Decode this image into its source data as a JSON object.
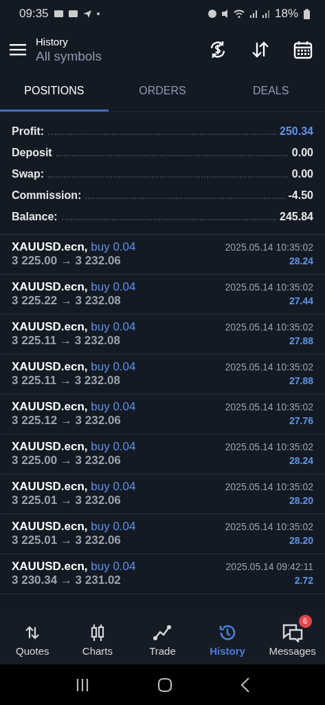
{
  "status_bar": {
    "time": "09:35",
    "battery": "18%"
  },
  "header": {
    "title": "History",
    "subtitle": "All symbols"
  },
  "tabs": [
    {
      "label": "POSITIONS",
      "selected": true
    },
    {
      "label": "ORDERS",
      "selected": false
    },
    {
      "label": "DEALS",
      "selected": false
    }
  ],
  "summary": [
    {
      "label": "Profit:",
      "value": "250.34",
      "highlight": true
    },
    {
      "label": "Deposit",
      "value": "0.00",
      "highlight": false
    },
    {
      "label": "Swap:",
      "value": "0.00",
      "highlight": false
    },
    {
      "label": "Commission:",
      "value": "-4.50",
      "highlight": false
    },
    {
      "label": "Balance:",
      "value": "245.84",
      "highlight": false
    }
  ],
  "positions": [
    {
      "symbol": "XAUUSD.ecn,",
      "side": "buy 0.04",
      "prices": "3 225.00 → 3 232.06",
      "time": "2025.05.14 10:35:02",
      "profit": "28.24"
    },
    {
      "symbol": "XAUUSD.ecn,",
      "side": "buy 0.04",
      "prices": "3 225.22 → 3 232.08",
      "time": "2025.05.14 10:35:02",
      "profit": "27.44"
    },
    {
      "symbol": "XAUUSD.ecn,",
      "side": "buy 0.04",
      "prices": "3 225.11 → 3 232.08",
      "time": "2025.05.14 10:35:02",
      "profit": "27.88"
    },
    {
      "symbol": "XAUUSD.ecn,",
      "side": "buy 0.04",
      "prices": "3 225.11 → 3 232.08",
      "time": "2025.05.14 10:35:02",
      "profit": "27.88"
    },
    {
      "symbol": "XAUUSD.ecn,",
      "side": "buy 0.04",
      "prices": "3 225.12 → 3 232.06",
      "time": "2025.05.14 10:35:02",
      "profit": "27.76"
    },
    {
      "symbol": "XAUUSD.ecn,",
      "side": "buy 0.04",
      "prices": "3 225.00 → 3 232.06",
      "time": "2025.05.14 10:35:02",
      "profit": "28.24"
    },
    {
      "symbol": "XAUUSD.ecn,",
      "side": "buy 0.04",
      "prices": "3 225.01 → 3 232.06",
      "time": "2025.05.14 10:35:02",
      "profit": "28.20"
    },
    {
      "symbol": "XAUUSD.ecn,",
      "side": "buy 0.04",
      "prices": "3 225.01 → 3 232.06",
      "time": "2025.05.14 10:35:02",
      "profit": "28.20"
    },
    {
      "symbol": "XAUUSD.ecn,",
      "side": "buy 0.04",
      "prices": "3 230.34 → 3 231.02",
      "time": "2025.05.14 09:42:11",
      "profit": "2.72"
    }
  ],
  "bottom_nav": [
    {
      "kind": "quotes",
      "label": "Quotes",
      "selected": false
    },
    {
      "kind": "charts",
      "label": "Charts",
      "selected": false
    },
    {
      "kind": "trade",
      "label": "Trade",
      "selected": false
    },
    {
      "kind": "history",
      "label": "History",
      "selected": true
    },
    {
      "kind": "messages",
      "label": "Messages",
      "selected": false,
      "badge": "6"
    }
  ]
}
